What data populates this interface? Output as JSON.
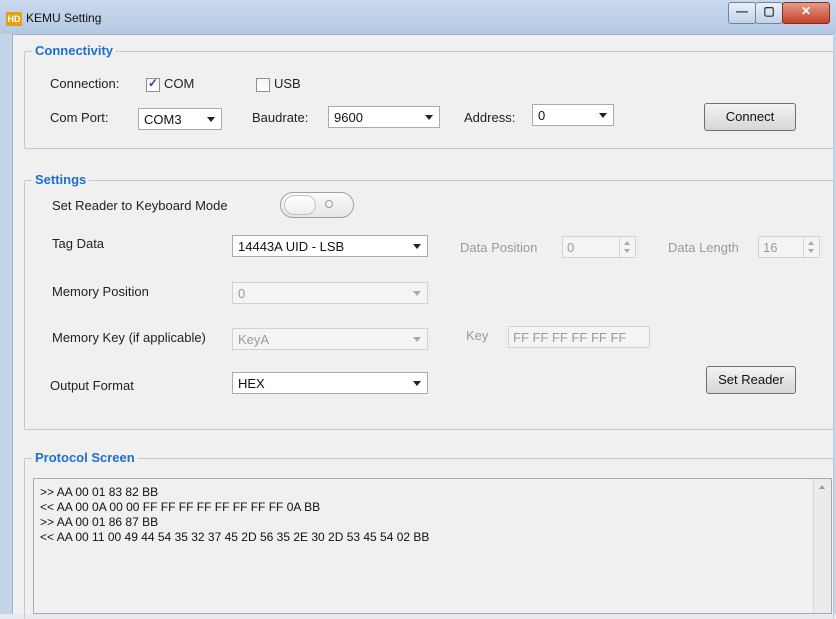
{
  "window": {
    "title": "KEMU Setting",
    "app_icon_text": "HD",
    "min_glyph": "—",
    "max_glyph": "▢",
    "close_glyph": "✕"
  },
  "connectivity": {
    "title": "Connectivity",
    "connection_label": "Connection:",
    "com_label": "COM",
    "com_checked": true,
    "usb_label": "USB",
    "usb_checked": false,
    "com_port_label": "Com Port:",
    "com_port_value": "COM3",
    "baudrate_label": "Baudrate:",
    "baudrate_value": "9600",
    "address_label": "Address:",
    "address_value": "0",
    "connect_label": "Connect"
  },
  "settings": {
    "title": "Settings",
    "keyboard_mode_label": "Set Reader to Keyboard Mode",
    "keyboard_mode_on": false,
    "tag_data_label": "Tag Data",
    "tag_data_value": "14443A UID - LSB",
    "data_position_label": "Data Position",
    "data_position_value": "0",
    "data_length_label": "Data Length",
    "data_length_value": "16",
    "memory_position_label": "Memory Position",
    "memory_position_value": "0",
    "memory_key_label": "Memory Key (if applicable)",
    "memory_key_value": "KeyA",
    "key_label": "Key",
    "key_value": "FF FF FF FF FF FF",
    "output_format_label": "Output Format",
    "output_format_value": "HEX",
    "set_reader_label": "Set Reader"
  },
  "protocol": {
    "title": "Protocol Screen",
    "lines": [
      ">> AA 00 01 83 82 BB",
      "<< AA 00 0A 00 00 FF FF FF FF FF FF FF FF 0A BB",
      ">> AA 00 01 86 87 BB",
      "<< AA 00 11 00 49 44 54 35 32 37 45 2D 56 35 2E 30 2D 53 45 54 02 BB"
    ]
  },
  "colors": {
    "group_title": "#1e6fd0",
    "close_button": "#c6422b"
  }
}
